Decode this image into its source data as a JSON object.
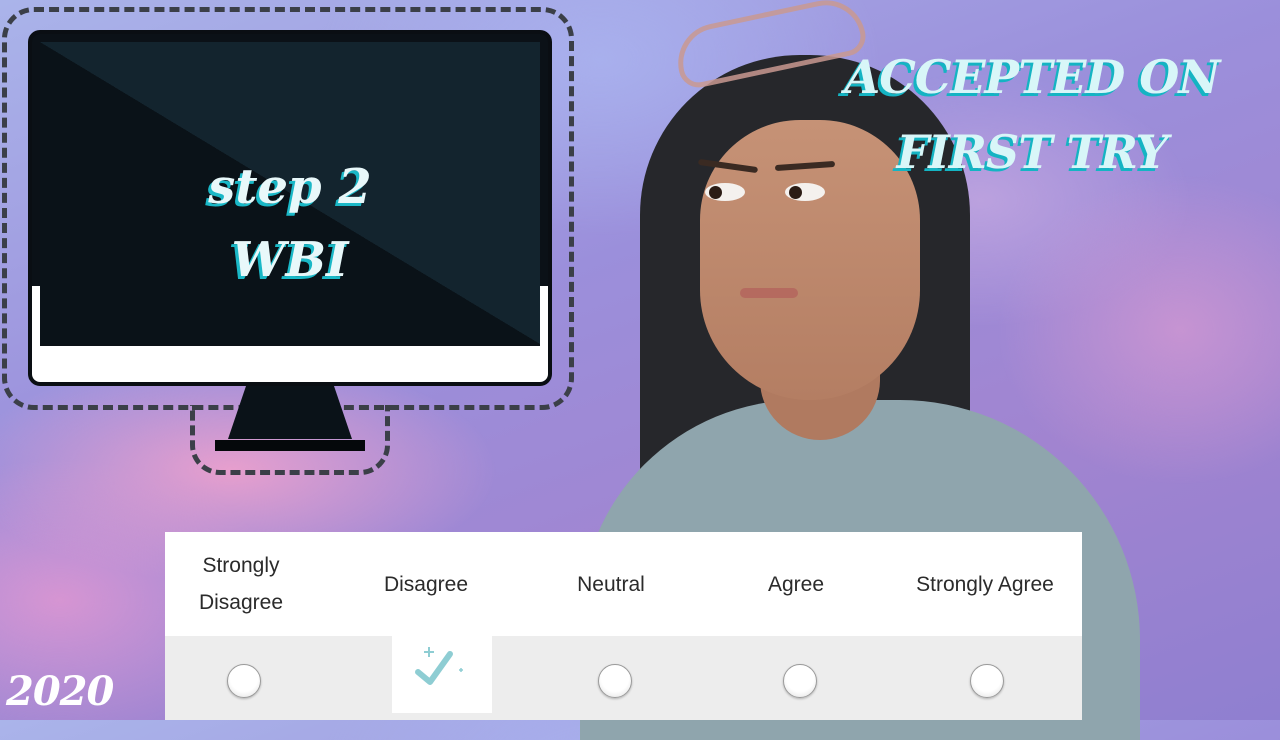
{
  "monitor_graphic": {
    "title": "step 2",
    "subtitle": "WBI"
  },
  "headline": {
    "line1": "ACCEPTED ON",
    "line2": "FIRST TRY"
  },
  "year_label": "2020",
  "rating_scale": {
    "options": [
      {
        "label": "Strongly Disagree",
        "line1": "Strongly",
        "line2": "Disagree",
        "selected": false
      },
      {
        "label": "Disagree",
        "selected": true
      },
      {
        "label": "Neutral",
        "selected": false
      },
      {
        "label": "Agree",
        "selected": false
      },
      {
        "label": "Strongly Agree",
        "selected": false
      }
    ]
  },
  "colors": {
    "accent_cyan": "#1ab8c7",
    "check_color": "#8ecdd3",
    "monitor_dark": "#0b1117"
  }
}
